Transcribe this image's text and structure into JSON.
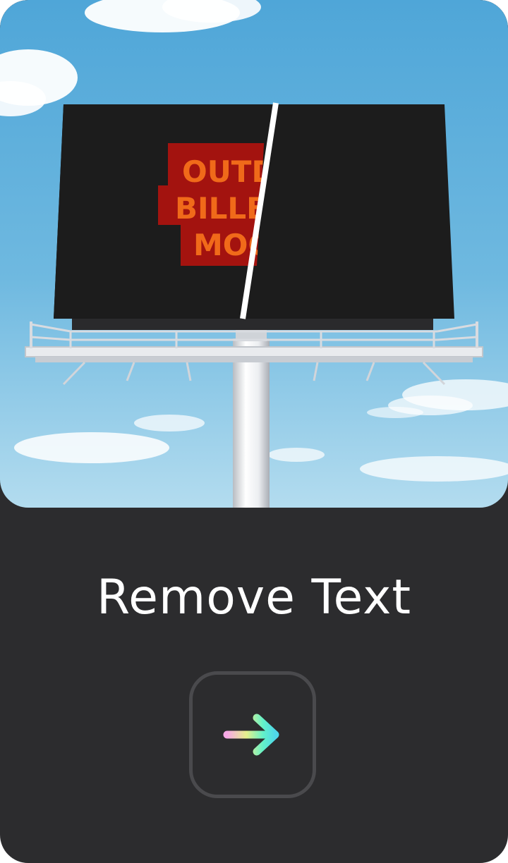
{
  "card": {
    "title": "Remove Text",
    "action_icon": "arrow-right-icon"
  },
  "preview": {
    "billboard_text": [
      "OUTD",
      "BILLB",
      "MOC"
    ],
    "comparison": "before-after-split"
  },
  "colors": {
    "card_background": "#2c2c2e",
    "button_border": "#4a4a4d",
    "sky_top": "#4fa6d8",
    "sky_bottom": "#b3dcef",
    "billboard_screen": "#1c1c1c",
    "billboard_panel": "#a3130f",
    "billboard_text": "#f06a1a",
    "arrow_gradient": [
      "#f7a8e6",
      "#e6f08c",
      "#62f1c9",
      "#4fd7e9"
    ]
  }
}
